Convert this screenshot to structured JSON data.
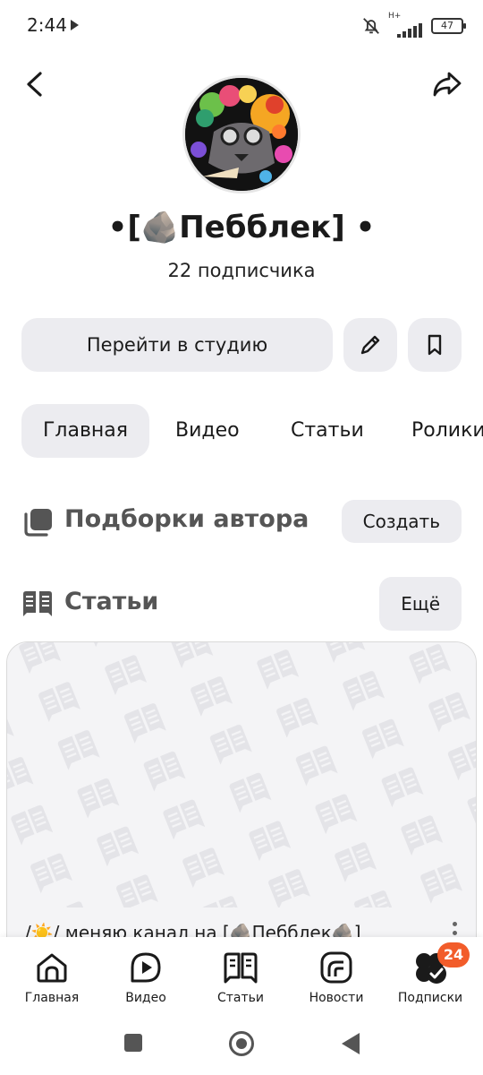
{
  "status_bar": {
    "time": "2:44",
    "network": "H+",
    "battery": "47"
  },
  "channel": {
    "title": "•[🪨Пебблек] •",
    "subscribers": "22 подписчика"
  },
  "actions": {
    "studio_label": "Перейти в студию"
  },
  "tabs": [
    {
      "label": "Главная",
      "active": true
    },
    {
      "label": "Видео",
      "active": false
    },
    {
      "label": "Статьи",
      "active": false
    },
    {
      "label": "Ролики",
      "active": false
    }
  ],
  "sections": {
    "collections": {
      "title": "Подборки автора",
      "button": "Создать"
    },
    "articles": {
      "title": "Статьи",
      "button": "Ещё"
    }
  },
  "article_card": {
    "caption": "/☀️/ меняю канал на [🪨Пебблек🪨]"
  },
  "bottom_nav": [
    {
      "label": "Главная",
      "icon": "home-icon"
    },
    {
      "label": "Видео",
      "icon": "video-icon"
    },
    {
      "label": "Статьи",
      "icon": "articles-icon"
    },
    {
      "label": "Новости",
      "icon": "news-icon"
    },
    {
      "label": "Подписки",
      "icon": "subscriptions-icon",
      "badge": "24"
    }
  ],
  "colors": {
    "button_bg": "#ececf0",
    "badge": "#f25c2a",
    "text": "#1a1a1a"
  }
}
